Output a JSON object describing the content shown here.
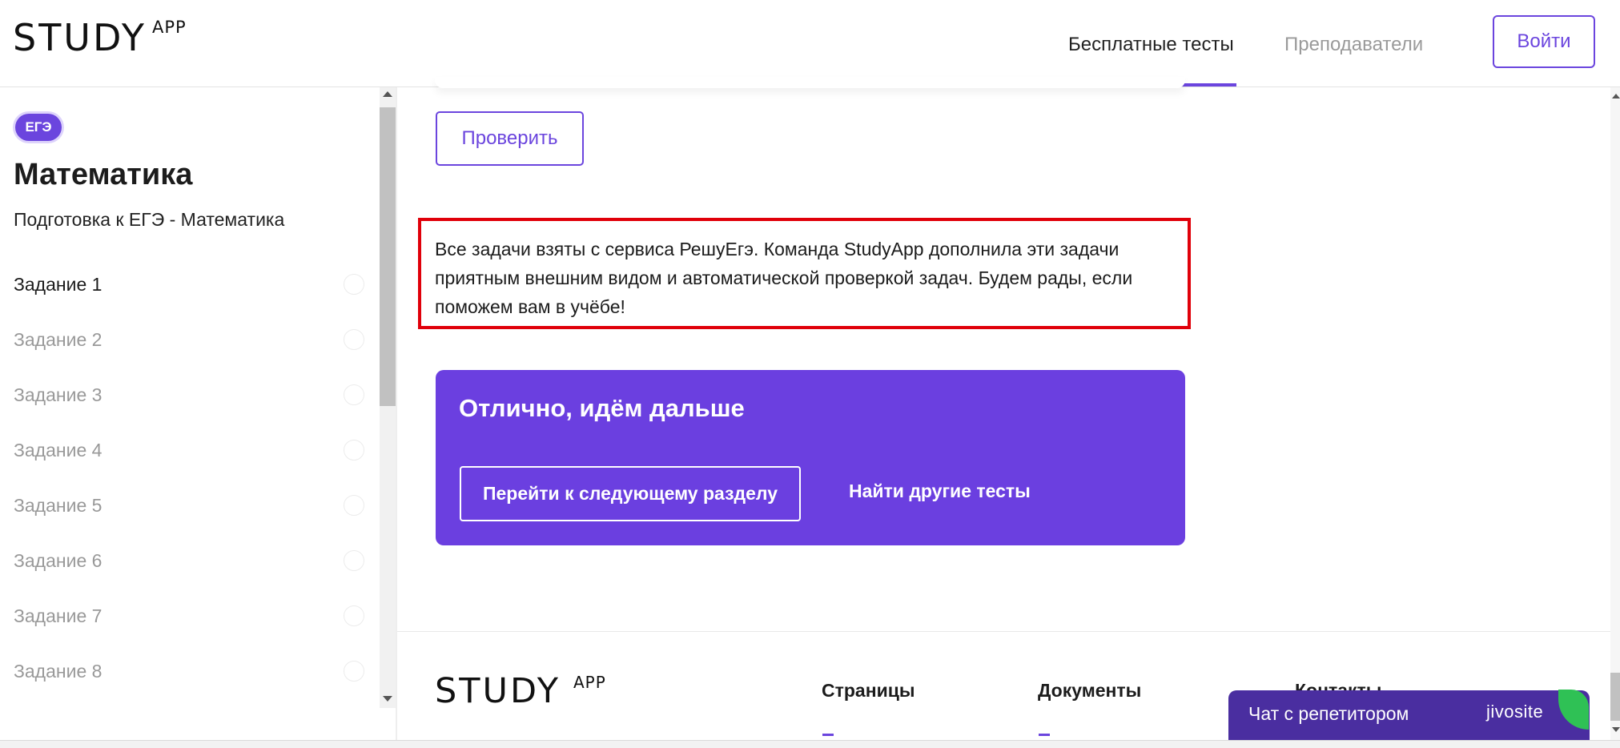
{
  "header": {
    "logo_text": "STUDY",
    "logo_sup": "APP",
    "nav": {
      "free_tests": "Бесплатные тесты",
      "teachers": "Преподаватели"
    },
    "login_label": "Войти"
  },
  "sidebar": {
    "badge": "ЕГЭ",
    "title": "Математика",
    "subtitle": "Подготовка к ЕГЭ - Математика",
    "tasks": [
      {
        "label": "Задание 1"
      },
      {
        "label": "Задание 2"
      },
      {
        "label": "Задание 3"
      },
      {
        "label": "Задание 4"
      },
      {
        "label": "Задание 5"
      },
      {
        "label": "Задание 6"
      },
      {
        "label": "Задание 7"
      },
      {
        "label": "Задание 8"
      }
    ]
  },
  "main": {
    "check_button": "Проверить",
    "notice": "Все задачи взяты с сервиса РешуЕгэ. Команда StudyApp дополнила эти задачи приятным внешним видом и автоматической проверкой задач. Будем рады, если поможем вам в учёбе!",
    "next_panel": {
      "title": "Отлично, идём дальше",
      "next_button": "Перейти к следующему разделу",
      "other_tests": "Найти другие тесты"
    }
  },
  "footer": {
    "logo_text": "STUDY",
    "logo_sup": "APP",
    "pages": "Страницы",
    "documents": "Документы",
    "contacts": "Контакты"
  },
  "chat": {
    "label": "Чат с репетитором",
    "brand": "jivosite"
  },
  "colors": {
    "accent": "#6b45de",
    "panel": "#6b3fe0",
    "notice_border": "#e0000a",
    "chat_bg": "#4a2ea0",
    "chat_corner": "#2fc155"
  }
}
